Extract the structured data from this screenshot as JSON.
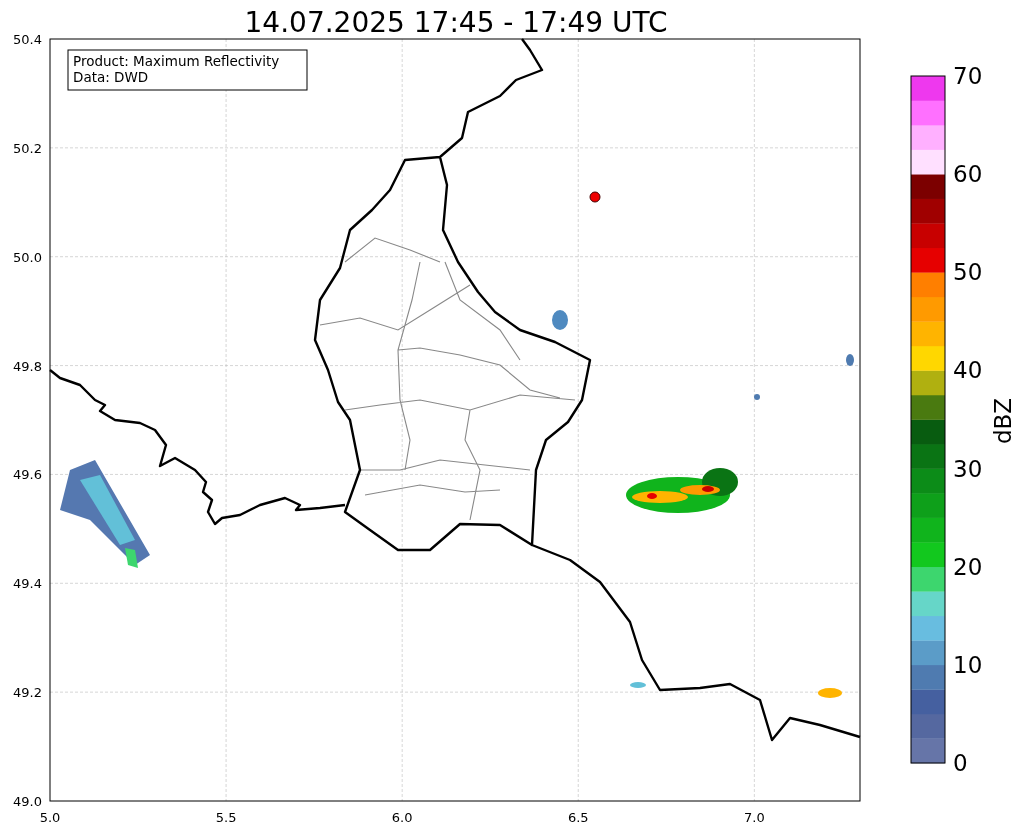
{
  "title": "14.07.2025 17:45 - 17:49 UTC",
  "info_box": {
    "lines": [
      "Product: Maximum Reflectivity",
      "Data: DWD"
    ]
  },
  "map": {
    "xticks": [
      "5.0",
      "5.5",
      "6.0",
      "6.5",
      "7.0"
    ],
    "yticks": [
      "50.4",
      "50.2",
      "50.0",
      "49.8",
      "49.6",
      "49.4",
      "49.2",
      "49.0"
    ]
  },
  "colorbar": {
    "label": "dBZ",
    "ticks": [
      "70",
      "60",
      "50",
      "40",
      "30",
      "20",
      "10",
      "0"
    ],
    "segments": [
      {
        "color": "#6675a8"
      },
      {
        "color": "#5568a0"
      },
      {
        "color": "#4560a0"
      },
      {
        "color": "#4f7bb0"
      },
      {
        "color": "#5b9cc8"
      },
      {
        "color": "#68bde0"
      },
      {
        "color": "#66d6c8"
      },
      {
        "color": "#3dd66e"
      },
      {
        "color": "#12c81e"
      },
      {
        "color": "#10b41c"
      },
      {
        "color": "#0ea01a"
      },
      {
        "color": "#0c8c18"
      },
      {
        "color": "#0a7414"
      },
      {
        "color": "#085c10"
      },
      {
        "color": "#4a7a10"
      },
      {
        "color": "#b0b010"
      },
      {
        "color": "#ffd700"
      },
      {
        "color": "#ffb400"
      },
      {
        "color": "#ff9a00"
      },
      {
        "color": "#ff7f00"
      },
      {
        "color": "#e60000"
      },
      {
        "color": "#c80000"
      },
      {
        "color": "#a00000"
      },
      {
        "color": "#7c0000"
      },
      {
        "color": "#ffe0ff"
      },
      {
        "color": "#ffb0ff"
      },
      {
        "color": "#ff70ff"
      },
      {
        "color": "#ee38ee"
      }
    ]
  }
}
